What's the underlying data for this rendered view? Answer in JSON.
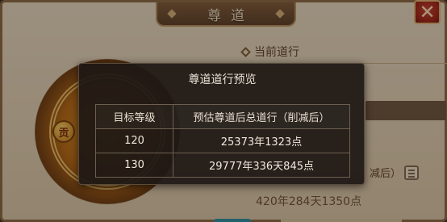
{
  "window": {
    "title": "尊道"
  },
  "background": {
    "current_label": "当前道行",
    "reduced_label": "减后）",
    "value_text": "420年284天1350点",
    "gift_badge": "贡"
  },
  "popup": {
    "title": "尊道道行预览",
    "columns": [
      "目标等级",
      "预估尊道后总道行（削减后）"
    ],
    "rows": [
      {
        "level": "120",
        "total": "25373年1323点"
      },
      {
        "level": "130",
        "total": "29777年336天845点"
      }
    ]
  },
  "colors": {
    "close_button": "#b02a1a",
    "title_bar": "#6b4a30",
    "popup_bg": "#1e1814"
  },
  "icons": {
    "close": "close-icon",
    "diamond": "diamond-icon",
    "document": "document-icon"
  }
}
